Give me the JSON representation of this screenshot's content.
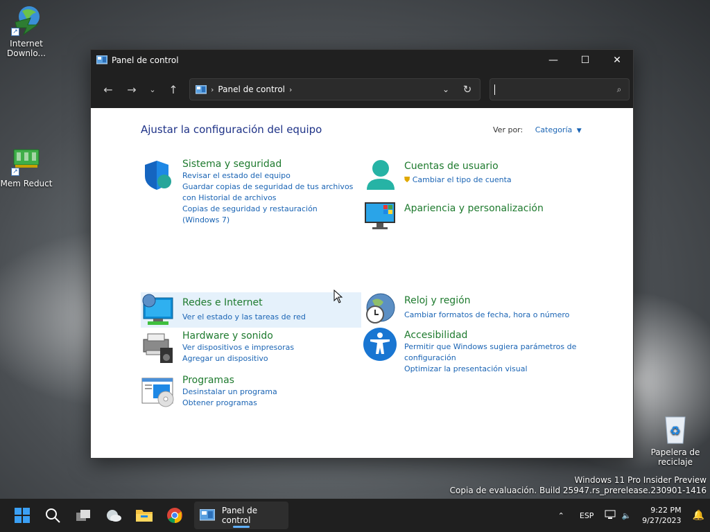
{
  "desktop": {
    "icons": [
      {
        "label": "Internet\nDownlo...",
        "icon": "internet-download-manager-icon"
      },
      {
        "label": "Mem Reduct",
        "icon": "mem-reduct-icon"
      },
      {
        "label": "Papelera de reciclaje",
        "icon": "recycle-bin-icon"
      }
    ],
    "watermark": {
      "line1": "Windows 11 Pro Insider Preview",
      "line2": "Copia de evaluación. Build 25947.rs_prerelease.230901-1416"
    }
  },
  "window": {
    "title": "Panel de control",
    "controls": {
      "minimize": "—",
      "maximize": "☐",
      "close": "✕"
    },
    "address": {
      "crumb": "Panel de control"
    },
    "search": {
      "value": "",
      "placeholder": ""
    },
    "heading": "Ajustar la configuración del equipo",
    "view_by": {
      "label": "Ver por:",
      "value": "Categoría"
    },
    "categories": [
      {
        "name": "Sistema y seguridad",
        "icon": "shield-icon",
        "links": [
          "Revisar el estado del equipo",
          "Guardar copias de seguridad de tus archivos con Historial de archivos",
          "Copias de seguridad y restauración (Windows 7)"
        ]
      },
      {
        "name": "Redes e Internet",
        "icon": "network-globe-icon",
        "links": [
          "Ver el estado y las tareas de red"
        ]
      },
      {
        "name": "Hardware y sonido",
        "icon": "printer-speaker-icon",
        "links": [
          "Ver dispositivos e impresoras",
          "Agregar un dispositivo"
        ]
      },
      {
        "name": "Programas",
        "icon": "programs-disc-icon",
        "links": [
          "Desinstalar un programa",
          "Obtener programas"
        ]
      },
      {
        "name": "Cuentas de usuario",
        "icon": "user-accounts-icon",
        "links": [
          "Cambiar el tipo de cuenta"
        ]
      },
      {
        "name": "Apariencia y personalización",
        "icon": "monitor-appearance-icon",
        "links": []
      },
      {
        "name": "Reloj y región",
        "icon": "clock-globe-icon",
        "links": [
          "Cambiar formatos de fecha, hora o número"
        ]
      },
      {
        "name": "Accesibilidad",
        "icon": "accessibility-icon",
        "links": [
          "Permitir que Windows sugiera parámetros de configuración",
          "Optimizar la presentación visual"
        ]
      }
    ]
  },
  "taskbar": {
    "active_app": "Panel de control",
    "language": "ESP",
    "time": "9:22 PM",
    "date": "9/27/2023"
  },
  "colors": {
    "category_title": "#1e7a2e",
    "link": "#1a64b4",
    "heading": "#1e3287",
    "titlebar": "#202020",
    "taskbar": "#1f1f1f"
  }
}
